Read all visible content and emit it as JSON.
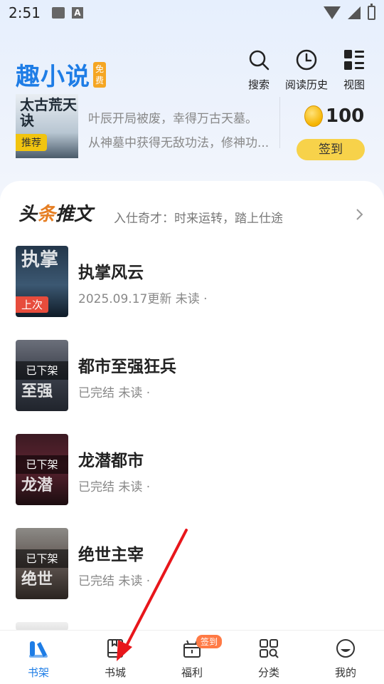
{
  "status_bar": {
    "time": "2:51",
    "a_icon": "A"
  },
  "header": {
    "logo": "趣小说",
    "logo_badge": "免费",
    "actions": [
      {
        "label": "搜索",
        "icon": "search-icon"
      },
      {
        "label": "阅读历史",
        "icon": "clock-icon"
      },
      {
        "label": "视图",
        "icon": "view-grid-icon"
      }
    ]
  },
  "recommend": {
    "cover_title": "太古荒天诀",
    "tag": "推荐",
    "line1": "叶辰开局被废，幸得万古天墓。",
    "line2": "从神墓中获得无敌功法，修神功...",
    "coins": "100",
    "signin": "签到"
  },
  "section": {
    "title_a": "头",
    "title_b": "条",
    "title_c": "推文",
    "subtitle": "入仕奇才：时来运转，踏上仕途"
  },
  "books": [
    {
      "name": "执掌风云",
      "meta": "2025.09.17更新 未读 ·",
      "badge": "上次",
      "cover_art": "执掌"
    },
    {
      "name": "都市至强狂兵",
      "meta": "已完结 未读 ·",
      "overlay": "已下架",
      "cover_art": "至强"
    },
    {
      "name": "龙潜都市",
      "meta": "已完结 未读 ·",
      "overlay": "已下架",
      "cover_art": "龙潜"
    },
    {
      "name": "绝世主宰",
      "meta": "已完结 未读 ·",
      "overlay": "已下架",
      "cover_art": "绝世"
    }
  ],
  "nav": [
    {
      "label": "书架",
      "icon": "bookshelf-icon",
      "active": true
    },
    {
      "label": "书城",
      "icon": "bookstore-icon"
    },
    {
      "label": "福利",
      "icon": "gift-icon",
      "badge": "签到"
    },
    {
      "label": "分类",
      "icon": "category-icon"
    },
    {
      "label": "我的",
      "icon": "profile-icon"
    }
  ],
  "colors": {
    "accent": "#1e7de6",
    "gold": "#f7d24a",
    "annotation": "#e8161b"
  }
}
